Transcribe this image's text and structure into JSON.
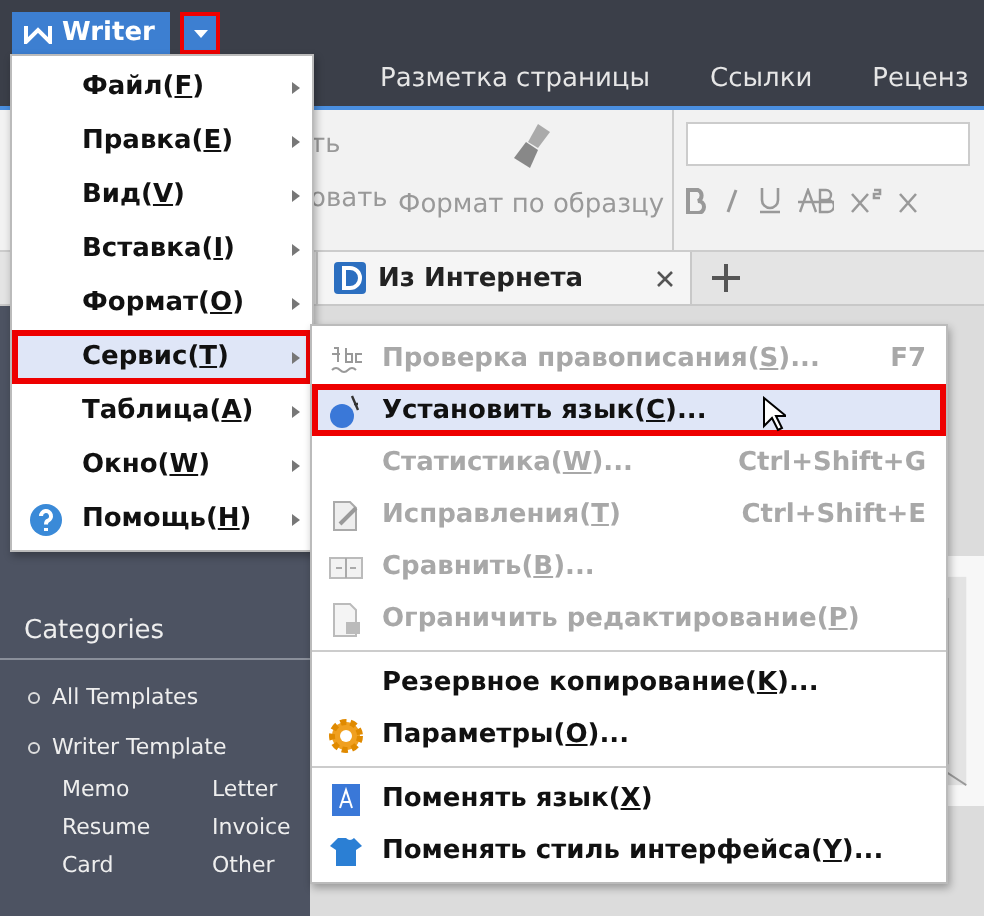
{
  "app_button": {
    "label": "Writer"
  },
  "menu_toggle": {
    "annotated": true
  },
  "ribbon_tabs": [
    {
      "label": "Разметка страницы"
    },
    {
      "label": "Ссылки"
    },
    {
      "label": "Реценз"
    }
  ],
  "ribbon": {
    "hidden_fragments": [
      "ть",
      "овать"
    ],
    "format_painter": "Формат по образцу",
    "format_buttons": [
      {
        "kind": "bold"
      },
      {
        "kind": "italic"
      },
      {
        "kind": "underline"
      },
      {
        "kind": "strike"
      },
      {
        "kind": "superscript"
      },
      {
        "kind": "subscript"
      }
    ]
  },
  "doc_tabs": [
    {
      "label": "Из Интернета",
      "selected": true
    }
  ],
  "sidebar": {
    "heading": "Categories",
    "items": [
      {
        "label": "All Templates"
      },
      {
        "label": "Writer Template",
        "children": [
          {
            "label": "Memo"
          },
          {
            "label": "Letter"
          },
          {
            "label": "Resume"
          },
          {
            "label": "Invoice"
          },
          {
            "label": "Card"
          },
          {
            "label": "Other"
          }
        ]
      }
    ]
  },
  "main_menu": [
    {
      "label_parts": [
        "Файл(",
        "F",
        ")"
      ],
      "selected": false,
      "annotated": false,
      "kind": "plain"
    },
    {
      "label_parts": [
        "Правка(",
        "E",
        ")"
      ],
      "selected": false,
      "annotated": false,
      "kind": "plain"
    },
    {
      "label_parts": [
        "Вид(",
        "V",
        ")"
      ],
      "selected": false,
      "annotated": false,
      "kind": "plain"
    },
    {
      "label_parts": [
        "Вставка(",
        "I",
        ")"
      ],
      "selected": false,
      "annotated": false,
      "kind": "plain"
    },
    {
      "label_parts": [
        "Формат(",
        "O",
        ")"
      ],
      "selected": false,
      "annotated": false,
      "kind": "plain"
    },
    {
      "label_parts": [
        "Сервис(",
        "T",
        ")"
      ],
      "selected": true,
      "annotated": true,
      "kind": "plain"
    },
    {
      "label_parts": [
        "Таблица(",
        "A",
        ")"
      ],
      "selected": false,
      "annotated": false,
      "kind": "plain"
    },
    {
      "label_parts": [
        "Окно(",
        "W",
        ")"
      ],
      "selected": false,
      "annotated": false,
      "kind": "plain"
    },
    {
      "label_parts": [
        "Помощь(",
        "H",
        ")"
      ],
      "selected": false,
      "annotated": false,
      "kind": "help"
    }
  ],
  "submenu": [
    {
      "label_parts": [
        "Проверка правописания(",
        "S",
        ")..."
      ],
      "shortcut": "F7",
      "disabled": true,
      "selected": false,
      "annotated": false,
      "kind": "spell",
      "separator_after": false
    },
    {
      "label_parts": [
        "Установить язык(",
        "C",
        ")..."
      ],
      "disabled": false,
      "selected": true,
      "annotated": true,
      "kind": "globe",
      "separator_after": false
    },
    {
      "label_parts": [
        "Статистика(",
        "W",
        ")..."
      ],
      "shortcut": "Ctrl+Shift+G",
      "disabled": true,
      "selected": false,
      "annotated": false,
      "kind": "plain",
      "separator_after": false
    },
    {
      "label_parts": [
        "Исправления(",
        "T",
        ")"
      ],
      "shortcut": "Ctrl+Shift+E",
      "disabled": true,
      "selected": false,
      "annotated": false,
      "kind": "edit",
      "separator_after": false
    },
    {
      "label_parts": [
        "Сравнить(",
        "B",
        ")..."
      ],
      "disabled": true,
      "selected": false,
      "annotated": false,
      "kind": "compare",
      "separator_after": false
    },
    {
      "label_parts": [
        "Ограничить редактирование(",
        "P",
        ")"
      ],
      "disabled": true,
      "selected": false,
      "annotated": false,
      "kind": "lock",
      "separator_after": true
    },
    {
      "label_parts": [
        "Резервное копирование(",
        "K",
        ")..."
      ],
      "disabled": false,
      "selected": false,
      "annotated": false,
      "kind": "plain",
      "separator_after": false
    },
    {
      "label_parts": [
        "Параметры(",
        "O",
        ")..."
      ],
      "disabled": false,
      "selected": false,
      "annotated": false,
      "kind": "gear",
      "separator_after": true
    },
    {
      "label_parts": [
        "Поменять язык(",
        "X",
        ")"
      ],
      "disabled": false,
      "selected": false,
      "annotated": false,
      "kind": "lang",
      "separator_after": false
    },
    {
      "label_parts": [
        "Поменять стиль интерфейса(",
        "Y",
        ")..."
      ],
      "disabled": false,
      "selected": false,
      "annotated": false,
      "kind": "shirt",
      "separator_after": false
    }
  ]
}
